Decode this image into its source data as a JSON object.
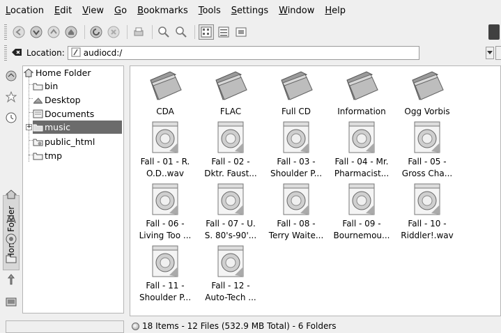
{
  "menubar": {
    "items": [
      "Location",
      "Edit",
      "View",
      "Go",
      "Bookmarks",
      "Tools",
      "Settings",
      "Window",
      "Help"
    ]
  },
  "toolbar": {
    "buttons": [
      "back-icon",
      "forward-icon",
      "up-icon",
      "home-icon",
      "reload-icon",
      "stop-icon",
      "print-icon",
      "zoom-in-icon",
      "zoom-out-icon",
      "icon-view-icon",
      "detailed-view-icon",
      "preview-icon"
    ]
  },
  "location": {
    "label": "Location:",
    "value": "audiocd:/"
  },
  "sidebar": {
    "tab_label": "Home Folder"
  },
  "tree": {
    "root": "Home Folder",
    "items": [
      {
        "label": "bin"
      },
      {
        "label": "Desktop"
      },
      {
        "label": "Documents"
      },
      {
        "label": "music",
        "selected": true
      },
      {
        "label": "public_html"
      },
      {
        "label": "tmp"
      }
    ]
  },
  "files": {
    "folders": [
      "CDA",
      "FLAC",
      "Full CD",
      "Information",
      "Ogg Vorbis"
    ],
    "tracks": [
      [
        "Fall - 01 - R.",
        "O.D..wav"
      ],
      [
        "Fall - 02 -",
        "Dktr. Faust..."
      ],
      [
        "Fall - 03 -",
        "Shoulder P..."
      ],
      [
        "Fall - 04 - Mr.",
        "Pharmacist..."
      ],
      [
        "Fall - 05 -",
        "Gross Cha..."
      ],
      [
        "Fall - 06 -",
        "Living Too ..."
      ],
      [
        "Fall - 07 - U.",
        "S. 80's-90'..."
      ],
      [
        "Fall - 08 -",
        "Terry Waite..."
      ],
      [
        "Fall - 09 -",
        "Bournemou..."
      ],
      [
        "Fall - 10 -",
        "Riddler!.wav"
      ],
      [
        "Fall - 11 -",
        "Shoulder P..."
      ],
      [
        "Fall - 12 -",
        "Auto-Tech ..."
      ]
    ]
  },
  "status": {
    "text": "18 Items - 12 Files (532.9 MB Total) - 6 Folders"
  },
  "colors": {
    "selection": "#6b6b6b",
    "window_bg": "#efefef"
  }
}
